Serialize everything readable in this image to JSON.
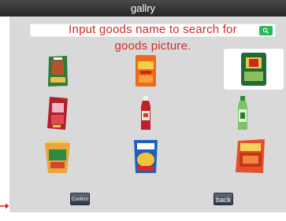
{
  "window": {
    "title": "gallry"
  },
  "search": {
    "hint": "Input goods name to search for goods picture.",
    "button_icon": "search-icon",
    "accent": "#2db558"
  },
  "gallery": {
    "items": [
      {
        "name": "meat-snack-pack",
        "selected": false
      },
      {
        "name": "orange-snack-pouch",
        "selected": false
      },
      {
        "name": "green-tea-box",
        "selected": true
      },
      {
        "name": "spicy-snack-pack",
        "selected": false
      },
      {
        "name": "red-drink-bottle",
        "selected": false
      },
      {
        "name": "green-tea-bottle",
        "selected": false
      },
      {
        "name": "milk-tea-cup",
        "selected": false
      },
      {
        "name": "potato-chips-bag",
        "selected": false
      },
      {
        "name": "chili-snack-bag",
        "selected": false
      }
    ]
  },
  "buttons": {
    "confirm": "Confirm",
    "back": "back"
  },
  "colors": {
    "hint_text": "#d42a2a",
    "panel": "#d9d9d9",
    "arrow": "#e02020"
  }
}
